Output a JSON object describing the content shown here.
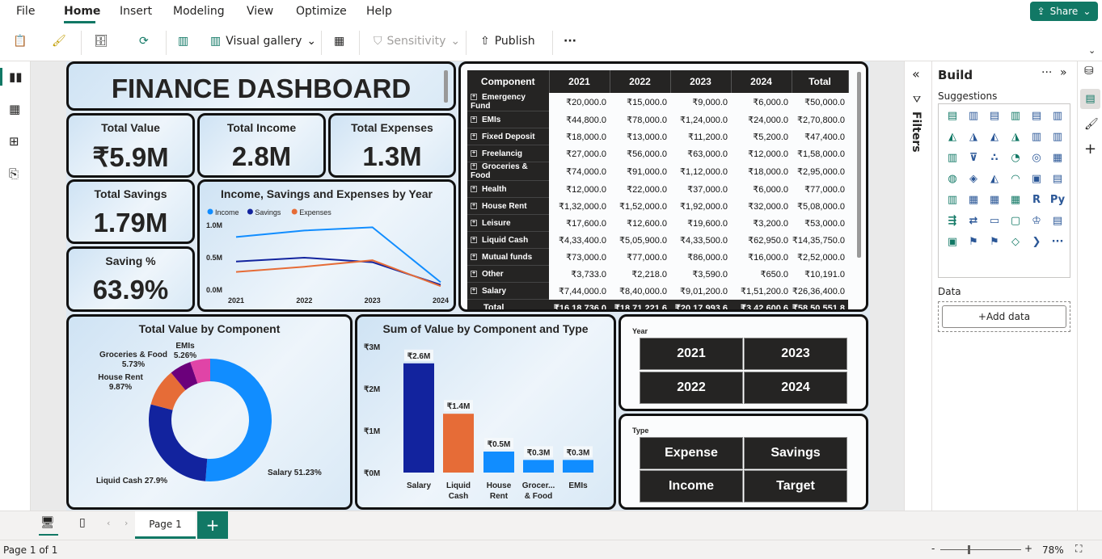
{
  "menu": {
    "items": [
      "File",
      "Home",
      "Insert",
      "Modeling",
      "View",
      "Optimize",
      "Help"
    ],
    "share": "Share"
  },
  "ribbon": {
    "visual_gallery": "Visual gallery",
    "sensitivity": "Sensitivity",
    "publish": "Publish",
    "more": "···"
  },
  "dashboard": {
    "title": "FINANCE DASHBOARD",
    "kpis": [
      {
        "title": "Total Value",
        "value": "₹5.9M"
      },
      {
        "title": "Total Income",
        "value": "2.8M"
      },
      {
        "title": "Total Expenses",
        "value": "1.3M"
      },
      {
        "title": "Total Savings",
        "value": "1.79M"
      },
      {
        "title": "Saving %",
        "value": "63.9%"
      }
    ],
    "line_title": "Income, Savings and Expenses by Year",
    "donut_title": "Total Value by Component",
    "bar_title": "Sum of Value by Component and Type"
  },
  "table": {
    "headers": [
      "Component",
      "2021",
      "2022",
      "2023",
      "2024",
      "Total"
    ],
    "rows": [
      [
        "Emergency Fund",
        "₹20,000.0",
        "₹15,000.0",
        "₹9,000.0",
        "₹6,000.0",
        "₹50,000.0"
      ],
      [
        "EMIs",
        "₹44,800.0",
        "₹78,000.0",
        "₹1,24,000.0",
        "₹24,000.0",
        "₹2,70,800.0"
      ],
      [
        "Fixed Deposit",
        "₹18,000.0",
        "₹13,000.0",
        "₹11,200.0",
        "₹5,200.0",
        "₹47,400.0"
      ],
      [
        "Freelancig",
        "₹27,000.0",
        "₹56,000.0",
        "₹63,000.0",
        "₹12,000.0",
        "₹1,58,000.0"
      ],
      [
        "Groceries & Food",
        "₹74,000.0",
        "₹91,000.0",
        "₹1,12,000.0",
        "₹18,000.0",
        "₹2,95,000.0"
      ],
      [
        "Health",
        "₹12,000.0",
        "₹22,000.0",
        "₹37,000.0",
        "₹6,000.0",
        "₹77,000.0"
      ],
      [
        "House Rent",
        "₹1,32,000.0",
        "₹1,52,000.0",
        "₹1,92,000.0",
        "₹32,000.0",
        "₹5,08,000.0"
      ],
      [
        "Leisure",
        "₹17,600.0",
        "₹12,600.0",
        "₹19,600.0",
        "₹3,200.0",
        "₹53,000.0"
      ],
      [
        "Liquid Cash",
        "₹4,33,400.0",
        "₹5,05,900.0",
        "₹4,33,500.0",
        "₹62,950.0",
        "₹14,35,750.0"
      ],
      [
        "Mutual funds",
        "₹73,000.0",
        "₹77,000.0",
        "₹86,000.0",
        "₹16,000.0",
        "₹2,52,000.0"
      ],
      [
        "Other",
        "₹3,733.0",
        "₹2,218.0",
        "₹3,590.0",
        "₹650.0",
        "₹10,191.0"
      ],
      [
        "Salary",
        "₹7,44,000.0",
        "₹8,40,000.0",
        "₹9,01,200.0",
        "₹1,51,200.0",
        "₹26,36,400.0"
      ]
    ],
    "total": [
      "Total",
      "₹16,18,736.0",
      "₹18,71,221.6",
      "₹20,17,993.6",
      "₹3,42,600.6",
      "₹58,50,551.8"
    ]
  },
  "slicers": {
    "year": {
      "title": "Year",
      "options": [
        "2021",
        "2023",
        "2022",
        "2024"
      ]
    },
    "type": {
      "title": "Type",
      "options": [
        "Expense",
        "Savings",
        "Income",
        "Target"
      ]
    }
  },
  "chart_data": [
    {
      "type": "line",
      "title": "Income, Savings and Expenses by Year",
      "x": [
        "2021",
        "2022",
        "2023",
        "2024"
      ],
      "ylim": [
        0,
        1.0
      ],
      "yticks": [
        "0.0M",
        "0.5M",
        "1.0M"
      ],
      "legend": "top-left",
      "series": [
        {
          "name": "Income",
          "values": [
            0.82,
            0.92,
            0.97,
            0.12
          ],
          "color": "#118dff"
        },
        {
          "name": "Savings",
          "values": [
            0.44,
            0.5,
            0.43,
            0.08
          ],
          "color": "#12239e"
        },
        {
          "name": "Expenses",
          "values": [
            0.28,
            0.36,
            0.46,
            0.06
          ],
          "color": "#e66c37"
        }
      ]
    },
    {
      "type": "pie",
      "title": "Total Value by Component",
      "slices": [
        {
          "label": "Salary",
          "value": 51.23,
          "display": "Salary 51.23%",
          "color": "#118dff"
        },
        {
          "label": "Liquid Cash",
          "value": 27.9,
          "display": "Liquid Cash 27.9%",
          "color": "#12239e"
        },
        {
          "label": "House Rent",
          "value": 9.87,
          "display": "House Rent\n9.87%",
          "color": "#e66c37"
        },
        {
          "label": "Groceries & Food",
          "value": 5.73,
          "display": "Groceries & Food\n5.73%",
          "color": "#6b007b"
        },
        {
          "label": "EMIs",
          "value": 5.26,
          "display": "EMIs\n5.26%",
          "color": "#e044a7"
        }
      ]
    },
    {
      "type": "bar",
      "title": "Sum of Value by Component and Type",
      "categories": [
        "Salary",
        "Liquid Cash",
        "House Rent",
        "Grocer... & Food",
        "EMIs"
      ],
      "values": [
        2.6,
        1.4,
        0.5,
        0.3,
        0.3
      ],
      "labels": [
        "₹2.6M",
        "₹1.4M",
        "₹0.5M",
        "₹0.3M",
        "₹0.3M"
      ],
      "colors": [
        "#12239e",
        "#e66c37",
        "#118dff",
        "#118dff",
        "#118dff"
      ],
      "ylim": [
        0,
        3
      ],
      "yticks": [
        "₹0M",
        "₹1M",
        "₹2M",
        "₹3M"
      ]
    }
  ],
  "panes": {
    "filters": "Filters",
    "build": "Build",
    "suggestions": "Suggestions",
    "data": "Data",
    "add_data": "+Add data"
  },
  "pages": {
    "current": "Page 1",
    "status": "Page 1 of 1",
    "zoom": "78%"
  }
}
